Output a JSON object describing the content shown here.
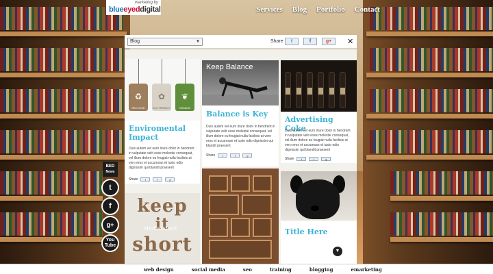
{
  "logo": {
    "tagline": "marketing by",
    "word_blue": "blue",
    "word_red": "eyed",
    "word_dark": "digital"
  },
  "nav": [
    "Services",
    "Blog",
    "Portfolio",
    "Contact"
  ],
  "panel": {
    "select_value": "Blog",
    "share_label": "Share",
    "close_label": "✕"
  },
  "cards": [
    {
      "title": "Enviromental Impact",
      "body": "Duis autem vel eum iriure dolor in hendrerit in vulputate velit esse molestie consequat, vel illum dolore eu feugiat nulla facilisis at vero eros et accumsan et iusto odio dignissim qui blandit praesent",
      "share_label": "Share",
      "tags": [
        "RECYCLED",
        "ECO FRIENDLY",
        "ORGANIC"
      ]
    },
    {
      "title": "Balance is Key",
      "image_caption": "Keep Balance",
      "body": "Duis autem vel eum iriure dolor in hendrerit in vulputate velit esse molestie consequat, vel illum dolore eu feugiat nulla facilisis at vero eros et accumsan et iusto odio dignissim qui blandit praesent",
      "share_label": "Share"
    },
    {
      "title": "Advertising Coke",
      "body": "Duis autem vel eum iriure dolor in hendrerit in vulputate velit esse molestie consequat, vel illum dolore eu feugiat nulla facilisis at vero eros et accumsan et iusto odio dignissim qui blandit praesent",
      "share_label": "Share"
    },
    {
      "image_words": [
        "keep",
        "it",
        "short"
      ],
      "watermark": "shutterstock"
    },
    {},
    {
      "title": "Title Here"
    }
  ],
  "social": {
    "badge_line1": "BED",
    "badge_line2": "News",
    "icons": [
      "twitter-icon",
      "facebook-icon",
      "google-plus-icon",
      "youtube-icon"
    ],
    "youtube_text": "You Tube"
  },
  "footer": [
    "web design",
    "social media",
    "seo",
    "training",
    "blogging",
    "emarketing"
  ],
  "colors": {
    "accent": "#3bb4d6",
    "footer_bg": "#ffffff"
  }
}
